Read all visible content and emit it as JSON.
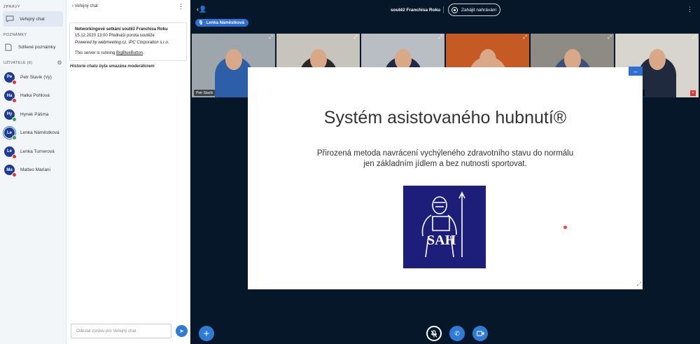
{
  "sidebar": {
    "messages_title": "ZPRÁVY",
    "public_chat_label": "Veřejný chat",
    "notes_title": "POZNÁMKY",
    "shared_notes_label": "Sdílené poznámky",
    "users_title": "UŽIVATELÉ (6)",
    "users": [
      {
        "initials": "Pe",
        "name": "Petr Slavík (Vy)",
        "mic": "muted",
        "voice": false
      },
      {
        "initials": "Ha",
        "name": "Halka Pohlová",
        "mic": "muted",
        "voice": false
      },
      {
        "initials": "Hy",
        "name": "Hynek Pášma",
        "mic": "on",
        "voice": false
      },
      {
        "initials": "Le",
        "name": "Lenka Náměstková",
        "mic": "on",
        "voice": true
      },
      {
        "initials": "Le",
        "name": "Lenka Turnerová",
        "mic": "muted",
        "voice": false
      },
      {
        "initials": "Ma",
        "name": "Matteo Mariani",
        "mic": "muted",
        "voice": false
      }
    ]
  },
  "chat": {
    "header_title": "Veřejný chat",
    "welcome_title": "Networkingové setkání soutěž Franchisa Roku",
    "welcome_line2": "15.12.2020 13:00 Přednáší porota soutěže",
    "welcome_powered": "Powered by webmeeting.cz, IPC Corporation s.r.o.",
    "welcome_server_prefix": "This server is running ",
    "welcome_server_link": "BigBlueButton",
    "welcome_server_suffix": ".",
    "cleared_notice": "Historie chatu byla smazána moderátorem",
    "input_placeholder": "Odeslat zprávu pro Veřejný chat"
  },
  "topbar": {
    "meeting_title": "soutěž Franchisa Roku",
    "record_label": "Zahájit nahrávání"
  },
  "talker": {
    "name": "Lenka Náměstková"
  },
  "videos": [
    {
      "name": "Petr Slavík",
      "bg": "#9ea6ad",
      "shirt": "#2d5fa8"
    },
    {
      "name": "Halka Pohlová",
      "bg": "#c7c4bd",
      "shirt": "#2a2a2a"
    },
    {
      "name": "Hynek Pášma",
      "bg": "#b8bec4",
      "shirt": "#1e2a44"
    },
    {
      "name": "Lenka Náměstková",
      "bg": "#c55a24",
      "shirt": "#d9a888"
    },
    {
      "name": "Lenka Turnerová",
      "bg": "#8e8a84",
      "shirt": "#3d4f7a"
    },
    {
      "name": "Matteo Mariani",
      "bg": "#d8d5cf",
      "shirt": "#1f2a3f"
    }
  ],
  "slide": {
    "title": "Systém asistovaného hubnutí®",
    "subtitle_line1": "Přirozená metoda navrácení vychýleného zdravotního stavu do normálu",
    "subtitle_line2": "jen základním jídlem a bez nutnosti sportovat.",
    "logo_text": "SAH",
    "logo_color": "#1d1d7a"
  },
  "colors": {
    "accent": "#2f7bd6",
    "main_bg": "#06172a",
    "muted": "#dd3333",
    "unmuted": "#2fa74a"
  }
}
